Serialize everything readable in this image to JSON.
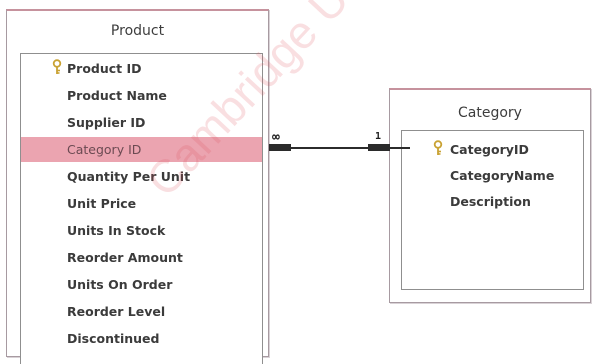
{
  "product": {
    "title": "Product",
    "fields": [
      {
        "label": "Product ID",
        "primary_key": true
      },
      {
        "label": "Product Name"
      },
      {
        "label": "Supplier ID"
      },
      {
        "label": "Category ID",
        "selected": true
      },
      {
        "label": "Quantity Per Unit"
      },
      {
        "label": "Unit Price"
      },
      {
        "label": "Units In Stock"
      },
      {
        "label": "Reorder Amount"
      },
      {
        "label": "Units On Order"
      },
      {
        "label": "Reorder Level"
      },
      {
        "label": "Discontinued"
      }
    ]
  },
  "category": {
    "title": "Category",
    "fields": [
      {
        "label": "CategoryID",
        "primary_key": true
      },
      {
        "label": "CategoryName"
      },
      {
        "label": "Description"
      }
    ]
  },
  "relationship": {
    "many_label": "∞",
    "one_label": "1"
  },
  "watermark": "Cambridge Univers",
  "colors": {
    "selected_row": "#eba4b0",
    "window_border": "#a79aa1",
    "key_icon": "#c9a233",
    "watermark": "#dc505a"
  },
  "icons": {
    "primary_key": "key-icon"
  }
}
